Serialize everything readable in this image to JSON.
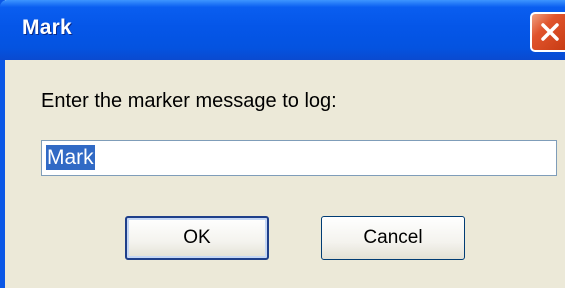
{
  "dialog": {
    "title": "Mark",
    "prompt": "Enter the marker message to log:",
    "input_value": "Mark",
    "ok_label": "OK",
    "cancel_label": "Cancel",
    "close_icon": "close-icon"
  },
  "colors": {
    "titlebar": "#0556e8",
    "body": "#ece9d8",
    "close": "#e0542c",
    "selection": "#316ac5"
  }
}
